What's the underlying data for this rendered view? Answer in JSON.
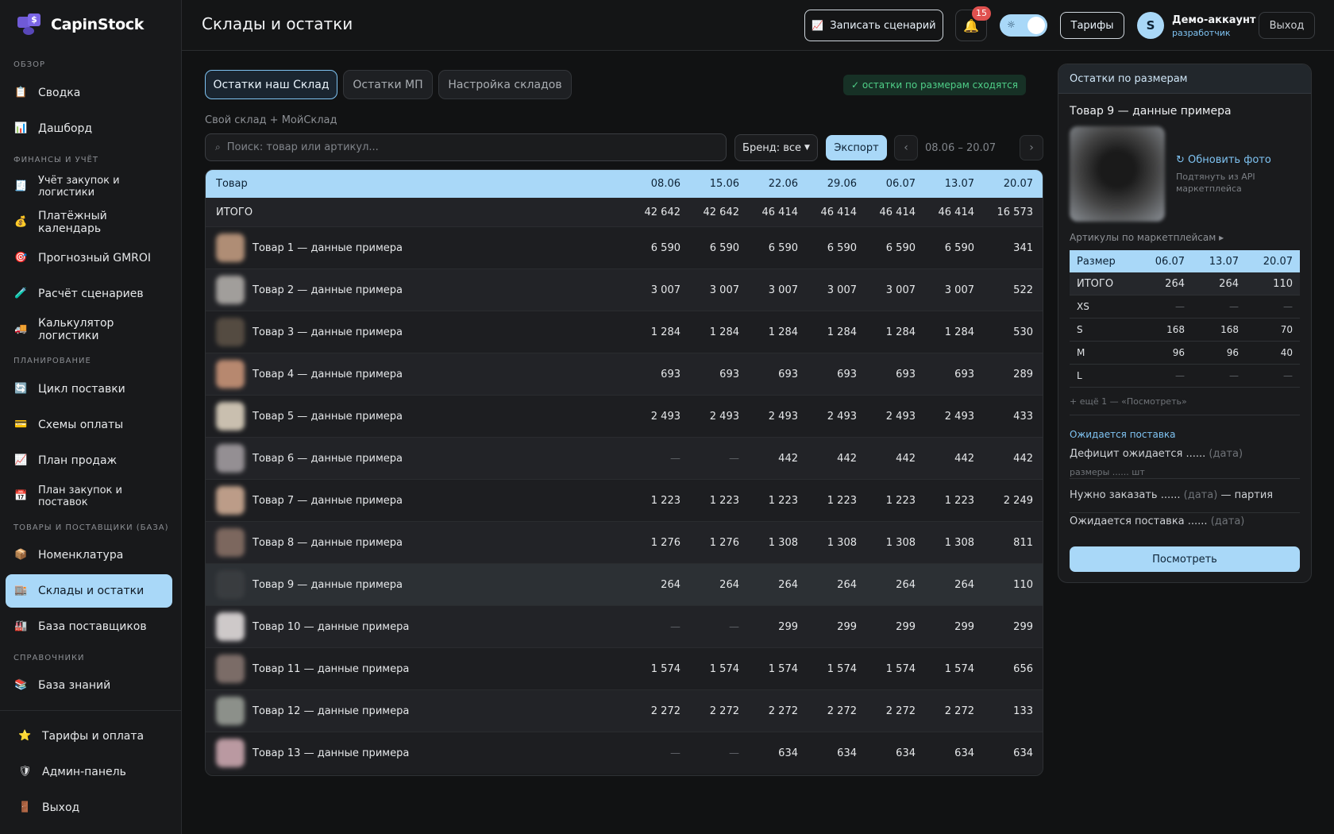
{
  "app": {
    "name": "CapinStock"
  },
  "sidebar": {
    "sections": [
      {
        "label": "ОБЗОР"
      },
      {
        "label": "ФИНАНСЫ И УЧЁТ"
      },
      {
        "label": "ПЛАНИРОВАНИЕ"
      },
      {
        "label": "ТОВАРЫ И ПОСТАВЩИКИ (БАЗА)"
      },
      {
        "label": "СПРАВОЧНИКИ"
      }
    ],
    "items": [
      {
        "label": "Сводка",
        "icon": "clipboard-icon"
      },
      {
        "label": "Дашборд",
        "icon": "bar-chart-icon"
      },
      {
        "label": "Учёт закупок и логистики",
        "icon": "receipt-icon"
      },
      {
        "label": "Платёжный календарь",
        "icon": "money-bag-icon"
      },
      {
        "label": "Прогнозный GMROI",
        "icon": "target-icon"
      },
      {
        "label": "Расчёт сценариев",
        "icon": "test-tube-icon"
      },
      {
        "label": "Калькулятор логистики",
        "icon": "truck-icon"
      },
      {
        "label": "Цикл поставки",
        "icon": "cycle-icon"
      },
      {
        "label": "Схемы оплаты",
        "icon": "credit-card-icon"
      },
      {
        "label": "План продаж",
        "icon": "trend-up-icon"
      },
      {
        "label": "План закупок и поставок",
        "icon": "calendar-icon"
      },
      {
        "label": "Номенклатура",
        "icon": "package-icon"
      },
      {
        "label": "Склады и остатки",
        "icon": "warehouse-icon"
      },
      {
        "label": "База поставщиков",
        "icon": "factory-icon"
      },
      {
        "label": "База знаний",
        "icon": "books-icon"
      }
    ],
    "bottom": [
      {
        "label": "Тарифы и оплата",
        "icon": "star-icon"
      },
      {
        "label": "Админ-панель",
        "icon": "shield-icon"
      },
      {
        "label": "Выход",
        "icon": "door-icon"
      }
    ]
  },
  "header": {
    "title": "Склады и остатки",
    "record_label": "Записать сценарий",
    "notifications": "15",
    "tariffs_label": "Тарифы",
    "avatar_letter": "S",
    "user_name": "Демо-аккаунт",
    "user_role": "разработчик",
    "logout_label": "Выход"
  },
  "tabs": [
    {
      "label": "Остатки наш Склад"
    },
    {
      "label": "Остатки МП"
    },
    {
      "label": "Настройка складов"
    }
  ],
  "status_ok": "✓ остатки по размерам сходятся",
  "subtitle": "Свой склад + МойСклад",
  "toolbar": {
    "search_placeholder": "Поиск: товар или артикул...",
    "brand_label": "Бренд: все",
    "export_label": "Экспорт",
    "prev": "‹",
    "next": "›",
    "date_range": "08.06 – 20.07"
  },
  "table": {
    "header_product": "Товар",
    "dates": [
      "08.06",
      "15.06",
      "22.06",
      "29.06",
      "06.07",
      "13.07",
      "20.07"
    ],
    "total_label": "ИТОГО",
    "totals": [
      "42 642",
      "42 642",
      "46 414",
      "46 414",
      "46 414",
      "46 414",
      "16 573"
    ],
    "rows": [
      {
        "name": "Товар 1 — данные примера",
        "values": [
          "6 590",
          "6 590",
          "6 590",
          "6 590",
          "6 590",
          "6 590",
          "341"
        ],
        "thumb": "#c9a184"
      },
      {
        "name": "Товар 2 — данные примера",
        "values": [
          "3 007",
          "3 007",
          "3 007",
          "3 007",
          "3 007",
          "3 007",
          "522"
        ],
        "thumb": "#b8b4b0"
      },
      {
        "name": "Товар 3 — данные примера",
        "values": [
          "1 284",
          "1 284",
          "1 284",
          "1 284",
          "1 284",
          "1 284",
          "530"
        ],
        "thumb": "#5e5347"
      },
      {
        "name": "Товар 4 — данные примера",
        "values": [
          "693",
          "693",
          "693",
          "693",
          "693",
          "693",
          "289"
        ],
        "thumb": "#d29a7c"
      },
      {
        "name": "Товар 5 — данные примера",
        "values": [
          "2 493",
          "2 493",
          "2 493",
          "2 493",
          "2 493",
          "2 493",
          "433"
        ],
        "thumb": "#e8dcc8"
      },
      {
        "name": "Товар 6 — данные примера",
        "values": [
          "—",
          "—",
          "442",
          "442",
          "442",
          "442",
          "442"
        ],
        "thumb": "#a8a2a6"
      },
      {
        "name": "Товар 7 — данные примера",
        "values": [
          "1 223",
          "1 223",
          "1 223",
          "1 223",
          "1 223",
          "1 223",
          "2 249"
        ],
        "thumb": "#d8b39a"
      },
      {
        "name": "Товар 8 — данные примера",
        "values": [
          "1 276",
          "1 276",
          "1 308",
          "1 308",
          "1 308",
          "1 308",
          "811"
        ],
        "thumb": "#8c7368"
      },
      {
        "name": "Товар 9 — данные примера",
        "values": [
          "264",
          "264",
          "264",
          "264",
          "264",
          "264",
          "110"
        ],
        "thumb": "#3c3f42"
      },
      {
        "name": "Товар 10 — данные примера",
        "values": [
          "—",
          "—",
          "299",
          "299",
          "299",
          "299",
          "299"
        ],
        "thumb": "#ece6e6"
      },
      {
        "name": "Товар 11 — данные примера",
        "values": [
          "1 574",
          "1 574",
          "1 574",
          "1 574",
          "1 574",
          "1 574",
          "656"
        ],
        "thumb": "#8c7a74"
      },
      {
        "name": "Товар 12 — данные примера",
        "values": [
          "2 272",
          "2 272",
          "2 272",
          "2 272",
          "2 272",
          "2 272",
          "133"
        ],
        "thumb": "#9fa49c"
      },
      {
        "name": "Товар 13 — данные примера",
        "values": [
          "—",
          "—",
          "634",
          "634",
          "634",
          "634",
          "634"
        ],
        "thumb": "#d6b0b8"
      }
    ],
    "selected_index": 8
  },
  "panel": {
    "title": "Остатки по размерам",
    "product": "Товар 9 — данные примера",
    "refresh_label": "↻ Обновить фото",
    "api_note": "Подтянуть из API маркетплейса",
    "articles_label": "Артикулы по маркетплейсам ▸",
    "size_header": "Размер",
    "size_dates": [
      "06.07",
      "13.07",
      "20.07"
    ],
    "size_rows": [
      {
        "label": "ИТОГО",
        "values": [
          "264",
          "264",
          "110"
        ]
      },
      {
        "label": "XS",
        "values": [
          "—",
          "—",
          "—"
        ]
      },
      {
        "label": "S",
        "values": [
          "168",
          "168",
          "70"
        ]
      },
      {
        "label": "M",
        "values": [
          "96",
          "96",
          "40"
        ]
      },
      {
        "label": "L",
        "values": [
          "—",
          "—",
          "—"
        ]
      }
    ],
    "more_label": "+ ещё 1 — «Посмотреть»",
    "expected_title": "Ожидается поставка",
    "deficit_text": "Дефицит ожидается ......",
    "deficit_date": "(дата)",
    "sizes_line": "размеры ...... шт",
    "order_text": "Нужно заказать ......",
    "order_date": "(дата)",
    "order_suffix": "— партия",
    "expected_text": "Ожидается поставка ......",
    "expected_date": "(дата)",
    "view_label": "Посмотреть"
  },
  "colors": {
    "accent": "#a9d8f8",
    "bg": "#111213",
    "ok": "#4fcf88",
    "badge": "#e0514f"
  }
}
